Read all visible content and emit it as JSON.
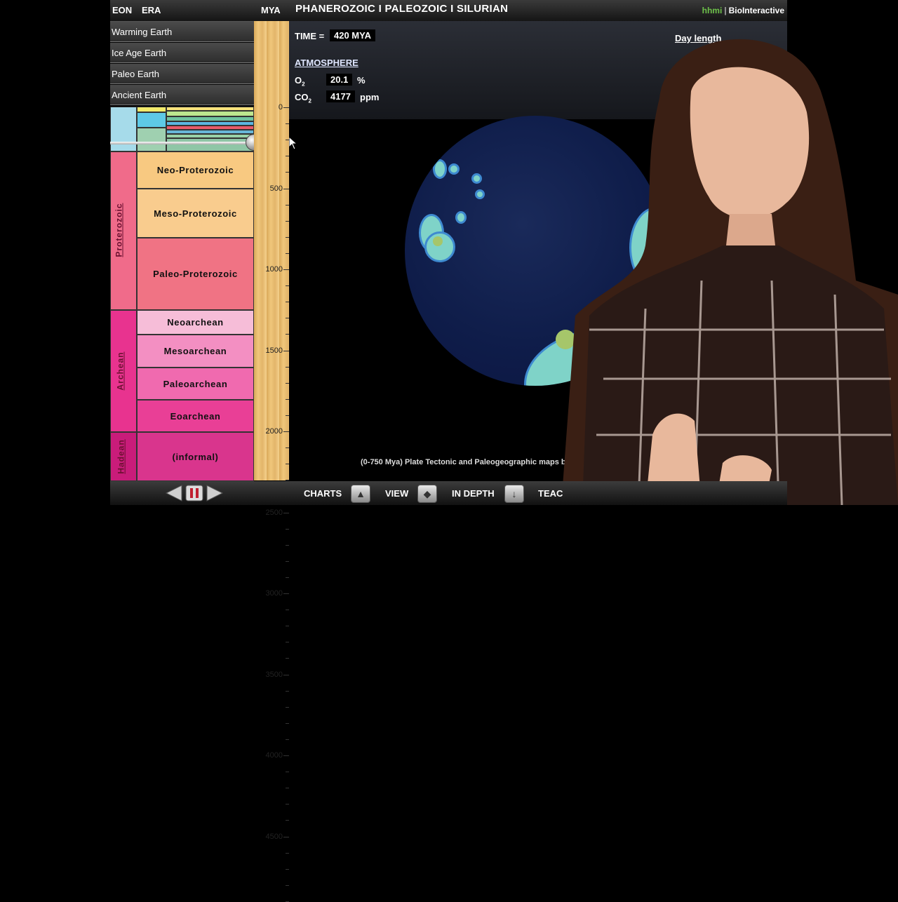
{
  "header": {
    "eon": "EON",
    "era": "ERA",
    "mya": "MYA",
    "title": "PHANEROZOIC I PALEOZOIC I SILURIAN",
    "brand_hhmi": "hhmi",
    "brand_name": "BioInteractive"
  },
  "menu": [
    "Warming Earth",
    "Ice Age Earth",
    "Paleo Earth",
    "Ancient Earth"
  ],
  "eons": [
    {
      "label": "Proterozoic",
      "color": "#f06b8a"
    },
    {
      "label": "Archean",
      "color": "#e8338f"
    },
    {
      "label": "Hadean",
      "color": "#c91c7a"
    }
  ],
  "eras": [
    {
      "label": "Neo-Proterozoic",
      "color": "#f8c981"
    },
    {
      "label": "Meso-Proterozoic",
      "color": "#f9cc8e"
    },
    {
      "label": "Paleo-Proterozoic",
      "color": "#f07384"
    },
    {
      "label": "Neoarchean",
      "color": "#f6bdd8"
    },
    {
      "label": "Mesoarchean",
      "color": "#f38fc2"
    },
    {
      "label": "Paleoarchean",
      "color": "#f06aaf"
    },
    {
      "label": "Eoarchean",
      "color": "#e93f96"
    },
    {
      "label": "(informal)",
      "color": "#d9358d"
    }
  ],
  "ruler_ticks": [
    "0",
    "500",
    "1000",
    "1500",
    "2000",
    "2500",
    "3000",
    "3500",
    "4000",
    "4500"
  ],
  "info": {
    "time_label": "TIME =",
    "time_value": "420 MYA",
    "day_length": "Day length",
    "atmosphere": "ATMOSPHERE",
    "o2_label": "O",
    "o2_sub": "2",
    "o2_value": "20.1",
    "o2_unit": "%",
    "co2_label": "CO",
    "co2_sub": "2",
    "co2_value": "4177",
    "co2_unit": "ppm"
  },
  "caption": "(0-750 Mya) Plate Tectonic and Paleogeographic maps by",
  "bottom": {
    "charts": "CHARTS",
    "view": "VIEW",
    "in_depth": "IN DEPTH",
    "teach": "TEAC"
  }
}
